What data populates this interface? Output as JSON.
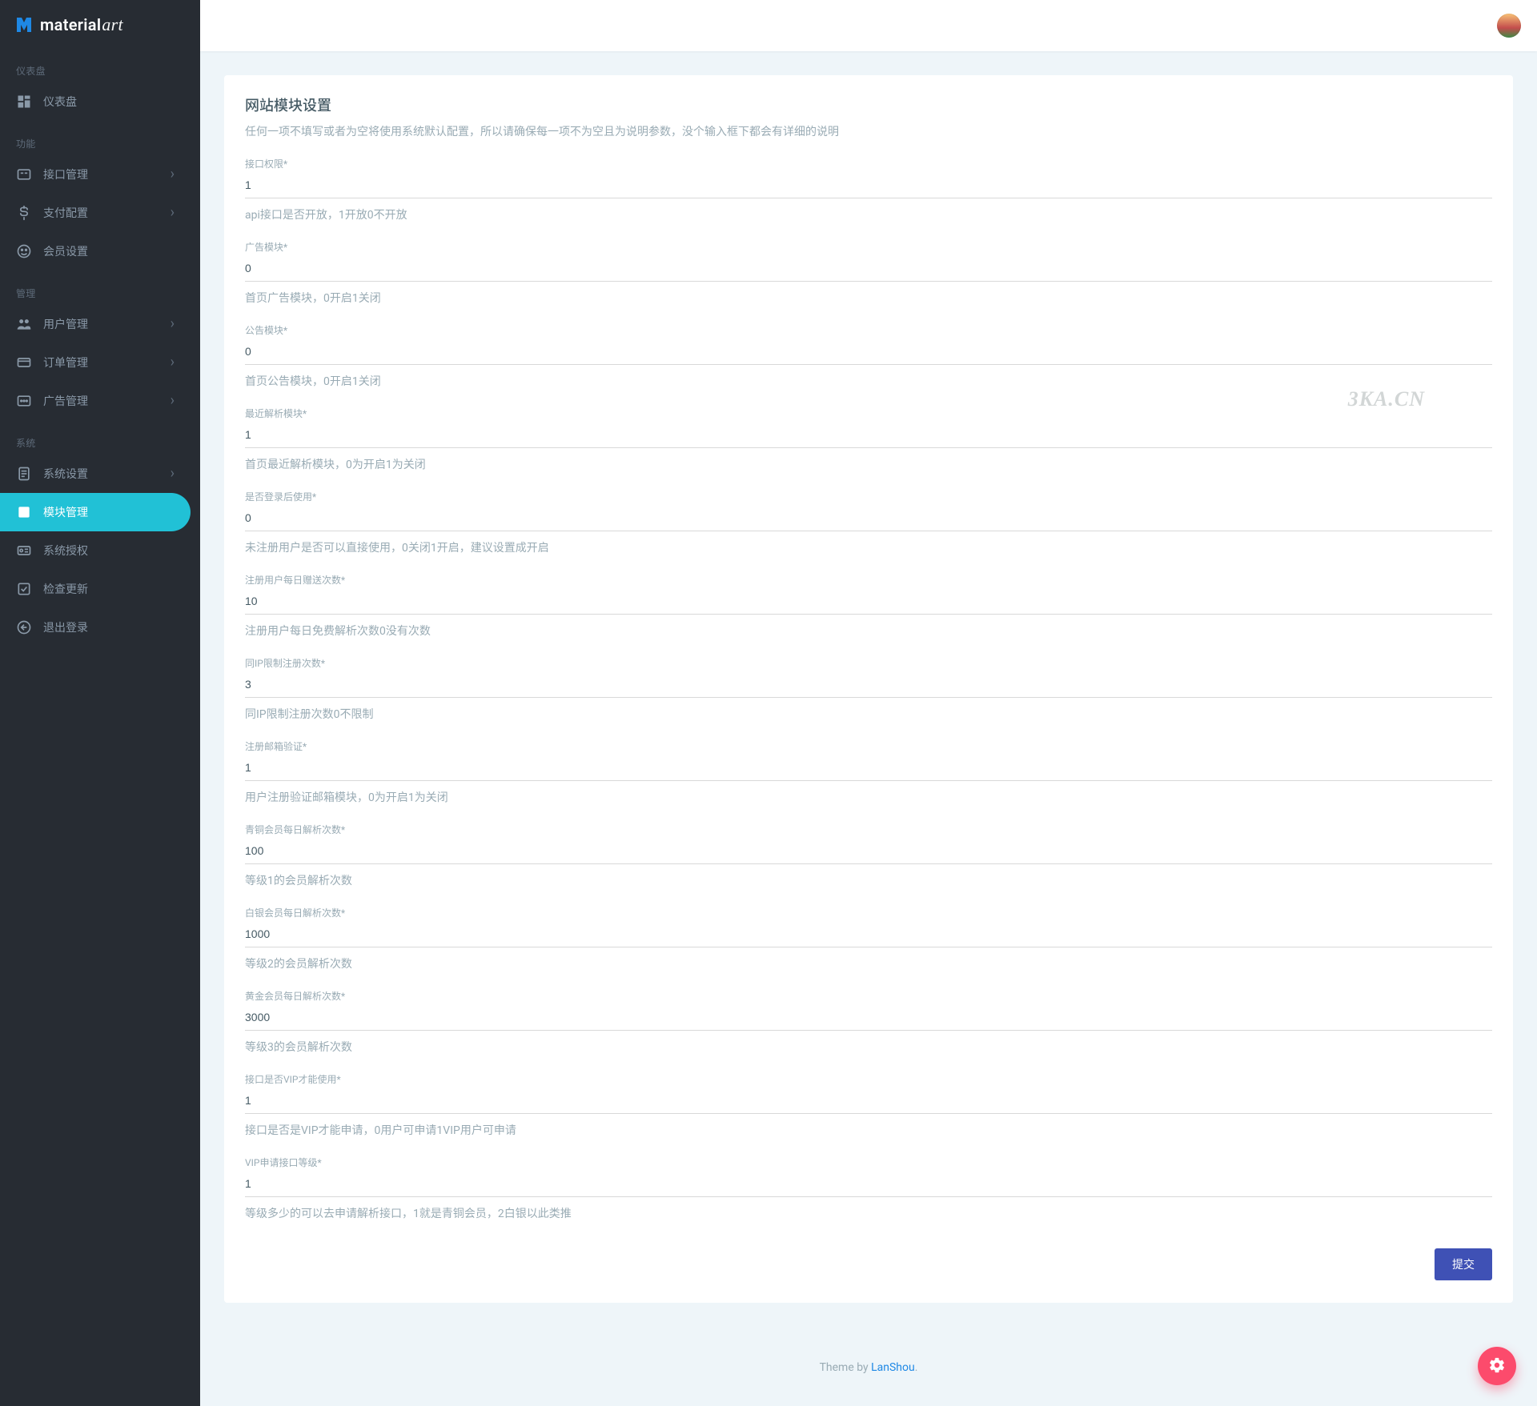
{
  "brand": {
    "name": "material",
    "suffix": "art"
  },
  "watermark": "3KA.CN",
  "sidebar": {
    "sections": [
      {
        "heading": "仪表盘",
        "items": [
          {
            "label": "仪表盘",
            "icon": "dashboard-icon",
            "expandable": false
          }
        ]
      },
      {
        "heading": "功能",
        "items": [
          {
            "label": "接口管理",
            "icon": "api-icon",
            "expandable": true
          },
          {
            "label": "支付配置",
            "icon": "dollar-icon",
            "expandable": true
          },
          {
            "label": "会员设置",
            "icon": "smile-icon",
            "expandable": false
          }
        ]
      },
      {
        "heading": "管理",
        "items": [
          {
            "label": "用户管理",
            "icon": "users-icon",
            "expandable": true
          },
          {
            "label": "订单管理",
            "icon": "card-icon",
            "expandable": true
          },
          {
            "label": "广告管理",
            "icon": "ad-icon",
            "expandable": true
          }
        ]
      },
      {
        "heading": "系统",
        "items": [
          {
            "label": "系统设置",
            "icon": "doc-icon",
            "expandable": true
          },
          {
            "label": "模块管理",
            "icon": "module-icon",
            "expandable": false,
            "active": true
          },
          {
            "label": "系统授权",
            "icon": "license-icon",
            "expandable": false
          },
          {
            "label": "检查更新",
            "icon": "update-icon",
            "expandable": false
          },
          {
            "label": "退出登录",
            "icon": "logout-icon",
            "expandable": false
          }
        ]
      }
    ]
  },
  "page": {
    "title": "网站模块设置",
    "subtitle": "任何一项不填写或者为空将使用系统默认配置，所以请确保每一项不为空且为说明参数，没个输入框下都会有详细的说明"
  },
  "form": {
    "fields": [
      {
        "label": "接口权限*",
        "value": "1",
        "help": "api接口是否开放，1开放0不开放"
      },
      {
        "label": "广告模块*",
        "value": "0",
        "help": "首页广告模块，0开启1关闭"
      },
      {
        "label": "公告模块*",
        "value": "0",
        "help": "首页公告模块，0开启1关闭"
      },
      {
        "label": "最近解析模块*",
        "value": "1",
        "help": "首页最近解析模块，0为开启1为关闭"
      },
      {
        "label": "是否登录后使用*",
        "value": "0",
        "help": "未注册用户是否可以直接使用，0关闭1开启，建议设置成开启"
      },
      {
        "label": "注册用户每日赠送次数*",
        "value": "10",
        "help": "注册用户每日免费解析次数0没有次数"
      },
      {
        "label": "同IP限制注册次数*",
        "value": "3",
        "help": "同IP限制注册次数0不限制"
      },
      {
        "label": "注册邮箱验证*",
        "value": "1",
        "help": "用户注册验证邮箱模块，0为开启1为关闭"
      },
      {
        "label": "青铜会员每日解析次数*",
        "value": "100",
        "help": "等级1的会员解析次数"
      },
      {
        "label": "白银会员每日解析次数*",
        "value": "1000",
        "help": "等级2的会员解析次数"
      },
      {
        "label": "黄金会员每日解析次数*",
        "value": "3000",
        "help": "等级3的会员解析次数"
      },
      {
        "label": "接口是否VIP才能使用*",
        "value": "1",
        "help": "接口是否是VIP才能申请，0用户可申请1VIP用户可申请"
      },
      {
        "label": "VIP申请接口等级*",
        "value": "1",
        "help": "等级多少的可以去申请解析接口，1就是青铜会员，2白银以此类推"
      }
    ],
    "submit": "提交"
  },
  "footer": {
    "prefix": "Theme by ",
    "link": "LanShou",
    "suffix": "."
  }
}
